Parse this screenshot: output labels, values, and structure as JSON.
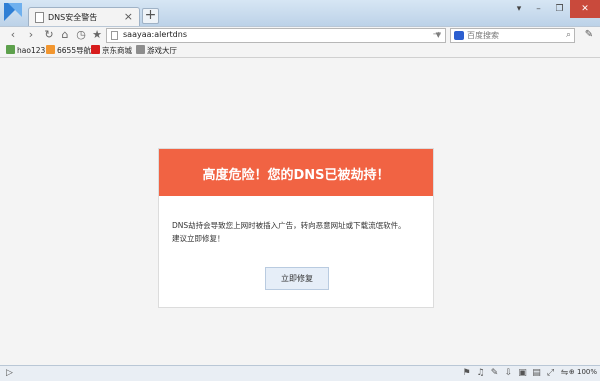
{
  "window": {
    "tab_title": "DNS安全警告",
    "tab_close": "×",
    "new_tab": "+",
    "controls": [
      "▾",
      "–",
      "❐",
      "✕"
    ]
  },
  "toolbar": {
    "back": "‹",
    "forward": "›",
    "reload": "↻",
    "home": "⌂",
    "history": "◷",
    "favorite": "★",
    "url": "saayaa:alertdns",
    "go": "→",
    "search_placeholder": "百度搜索",
    "search_engine_icon": "baidu-icon",
    "menu": "🔧"
  },
  "bookmarks": [
    {
      "label": "hao123",
      "icon_color": "#5da04c"
    },
    {
      "label": "6655导航",
      "icon_color": "#f2962f"
    },
    {
      "label": "京东商城",
      "icon_color": "#d71c1c"
    },
    {
      "label": "游戏大厅",
      "icon_color": "#8d8d8d"
    }
  ],
  "alert": {
    "title": "高度危险！您的DNS已被劫持！",
    "line1": "DNS劫持会导致您上网时被插入广告，转向恶意网址或下载流氓软件。",
    "line2": "建议立即修复！",
    "button": "立即修复",
    "header_color": "#f16343"
  },
  "statusbar": {
    "left": "▷",
    "zoom": "100%"
  }
}
